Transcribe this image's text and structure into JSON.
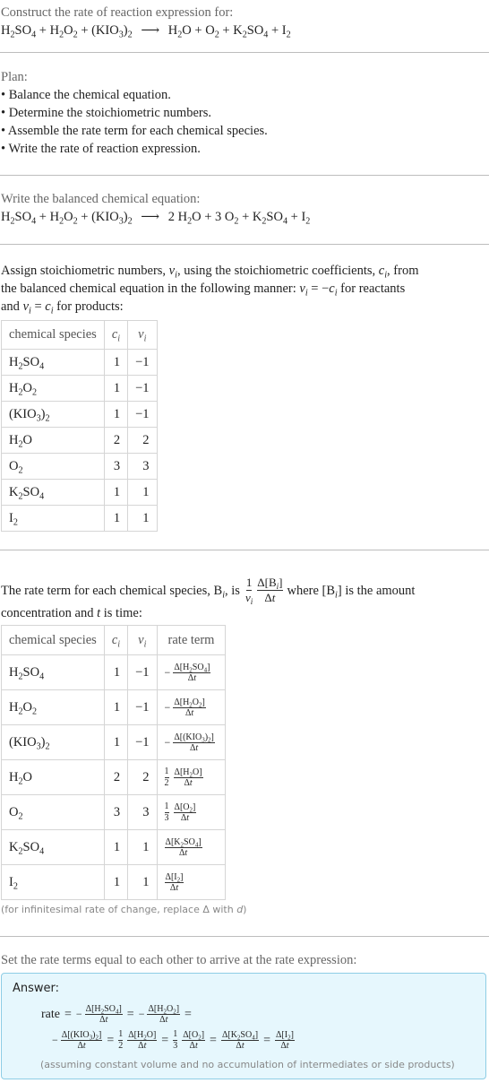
{
  "intro": {
    "heading": "Construct the rate of reaction expression for:",
    "reaction": {
      "reactants": [
        "H2SO4",
        "H2O2",
        "(KIO3)2"
      ],
      "products": [
        "H2O",
        "O2",
        "K2SO4",
        "I2"
      ],
      "arrow": "⟶"
    }
  },
  "plan": {
    "heading": "Plan:",
    "steps": [
      "• Balance the chemical equation.",
      "• Determine the stoichiometric numbers.",
      "• Assemble the rate term for each chemical species.",
      "• Write the rate of reaction expression."
    ]
  },
  "balanced": {
    "heading": "Write the balanced chemical equation:",
    "equation": "H2SO4 + H2O2 + (KIO3)2 ⟶ 2 H2O + 3 O2 + K2SO4 + I2"
  },
  "stoich": {
    "text_line1": "Assign stoichiometric numbers, νi, using the stoichiometric coefficients, ci, from",
    "text_line2": "the balanced chemical equation in the following manner: νi = −ci for reactants",
    "text_line3": "and νi = ci for products:",
    "table": {
      "headers": [
        "chemical species",
        "ci",
        "νi"
      ],
      "rows": [
        {
          "species": "H2SO4",
          "c": "1",
          "nu": "−1"
        },
        {
          "species": "H2O2",
          "c": "1",
          "nu": "−1"
        },
        {
          "species": "(KIO3)2",
          "c": "1",
          "nu": "−1"
        },
        {
          "species": "H2O",
          "c": "2",
          "nu": "2"
        },
        {
          "species": "O2",
          "c": "3",
          "nu": "3"
        },
        {
          "species": "K2SO4",
          "c": "1",
          "nu": "1"
        },
        {
          "species": "I2",
          "c": "1",
          "nu": "1"
        }
      ]
    }
  },
  "rate_terms": {
    "text_part1": "The rate term for each chemical species, Bi, is",
    "text_part2": "where [Bi] is the amount",
    "text_line2": "concentration and t is time:",
    "table": {
      "headers": [
        "chemical species",
        "ci",
        "νi",
        "rate term"
      ],
      "rows": [
        {
          "species": "H2SO4",
          "c": "1",
          "nu": "−1",
          "sign": "−",
          "coef": "",
          "conc": "Δ[H2SO4]",
          "den": "Δt"
        },
        {
          "species": "H2O2",
          "c": "1",
          "nu": "−1",
          "sign": "−",
          "coef": "",
          "conc": "Δ[H2O2]",
          "den": "Δt"
        },
        {
          "species": "(KIO3)2",
          "c": "1",
          "nu": "−1",
          "sign": "−",
          "coef": "",
          "conc": "Δ[(KIO3)2]",
          "den": "Δt"
        },
        {
          "species": "H2O",
          "c": "2",
          "nu": "2",
          "sign": "",
          "coef": "1/2",
          "conc": "Δ[H2O]",
          "den": "Δt"
        },
        {
          "species": "O2",
          "c": "3",
          "nu": "3",
          "sign": "",
          "coef": "1/3",
          "conc": "Δ[O2]",
          "den": "Δt"
        },
        {
          "species": "K2SO4",
          "c": "1",
          "nu": "1",
          "sign": "",
          "coef": "",
          "conc": "Δ[K2SO4]",
          "den": "Δt"
        },
        {
          "species": "I2",
          "c": "1",
          "nu": "1",
          "sign": "",
          "coef": "",
          "conc": "Δ[I2]",
          "den": "Δt"
        }
      ],
      "footnote": "(for infinitesimal rate of change, replace Δ with d)"
    }
  },
  "final": {
    "heading": "Set the rate terms equal to each other to arrive at the rate expression:",
    "answer_label": "Answer:",
    "rate_word": "rate",
    "equals": "=",
    "assumption": "(assuming constant volume and no accumulation of intermediates or side products)"
  },
  "colors": {
    "answer_bg": "#e6f7fd",
    "answer_border": "#8ecde5",
    "divider": "#bdbdbd"
  }
}
